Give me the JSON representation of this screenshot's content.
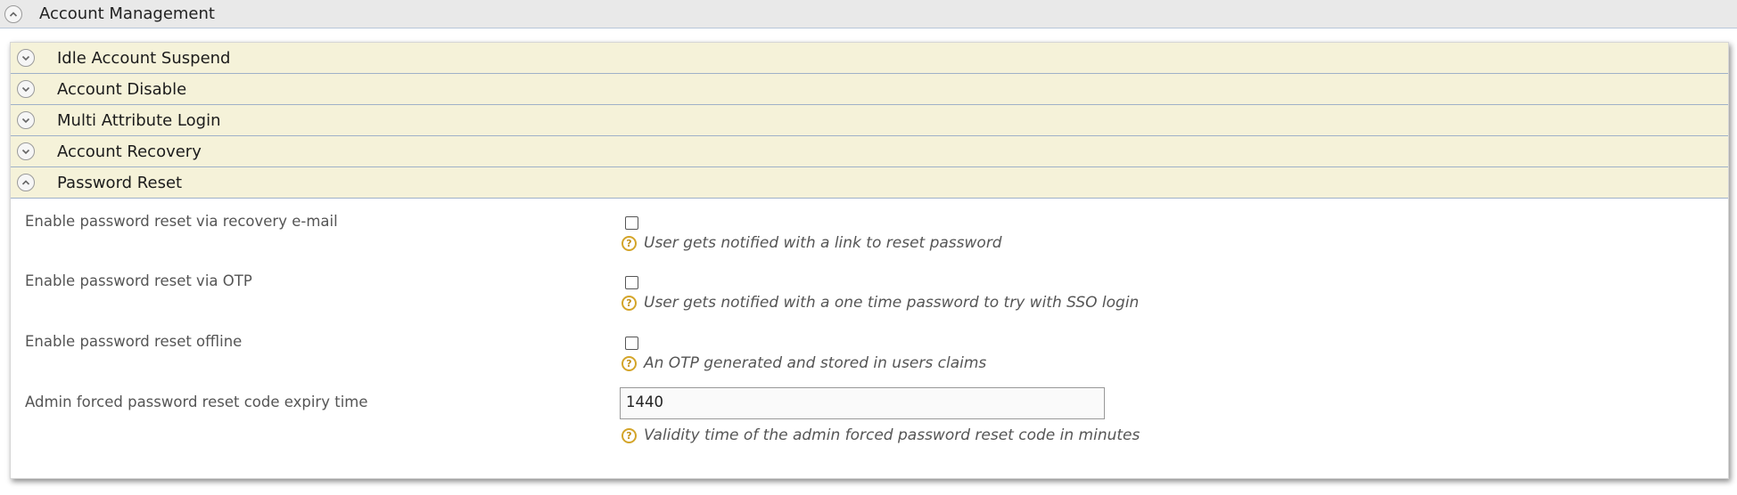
{
  "header": {
    "title": "Account Management",
    "toggle_icon": "chevron-up-icon"
  },
  "sections": [
    {
      "label": "Idle Account Suspend",
      "state": "collapsed",
      "icon": "chevron-down-icon"
    },
    {
      "label": "Account Disable",
      "state": "collapsed",
      "icon": "chevron-down-icon"
    },
    {
      "label": "Multi Attribute Login",
      "state": "collapsed",
      "icon": "chevron-down-icon"
    },
    {
      "label": "Account Recovery",
      "state": "collapsed",
      "icon": "chevron-down-icon"
    },
    {
      "label": "Password Reset",
      "state": "expanded",
      "icon": "chevron-up-icon"
    }
  ],
  "password_reset": {
    "fields": [
      {
        "label": "Enable password reset via recovery e-mail",
        "type": "checkbox",
        "checked": false,
        "help": "User gets notified with a link to reset password"
      },
      {
        "label": "Enable password reset via OTP",
        "type": "checkbox",
        "checked": false,
        "help": "User gets notified with a one time password to try with SSO login"
      },
      {
        "label": "Enable password reset offline",
        "type": "checkbox",
        "checked": false,
        "help": "An OTP generated and stored in users claims"
      },
      {
        "label": "Admin forced password reset code expiry time",
        "type": "text",
        "value": "1440",
        "help": "Validity time of the admin forced password reset code in minutes"
      }
    ]
  },
  "colors": {
    "header_bg": "#e9e9e9",
    "section_bg": "#f5f2d9",
    "help_icon": "#d4a52a"
  }
}
